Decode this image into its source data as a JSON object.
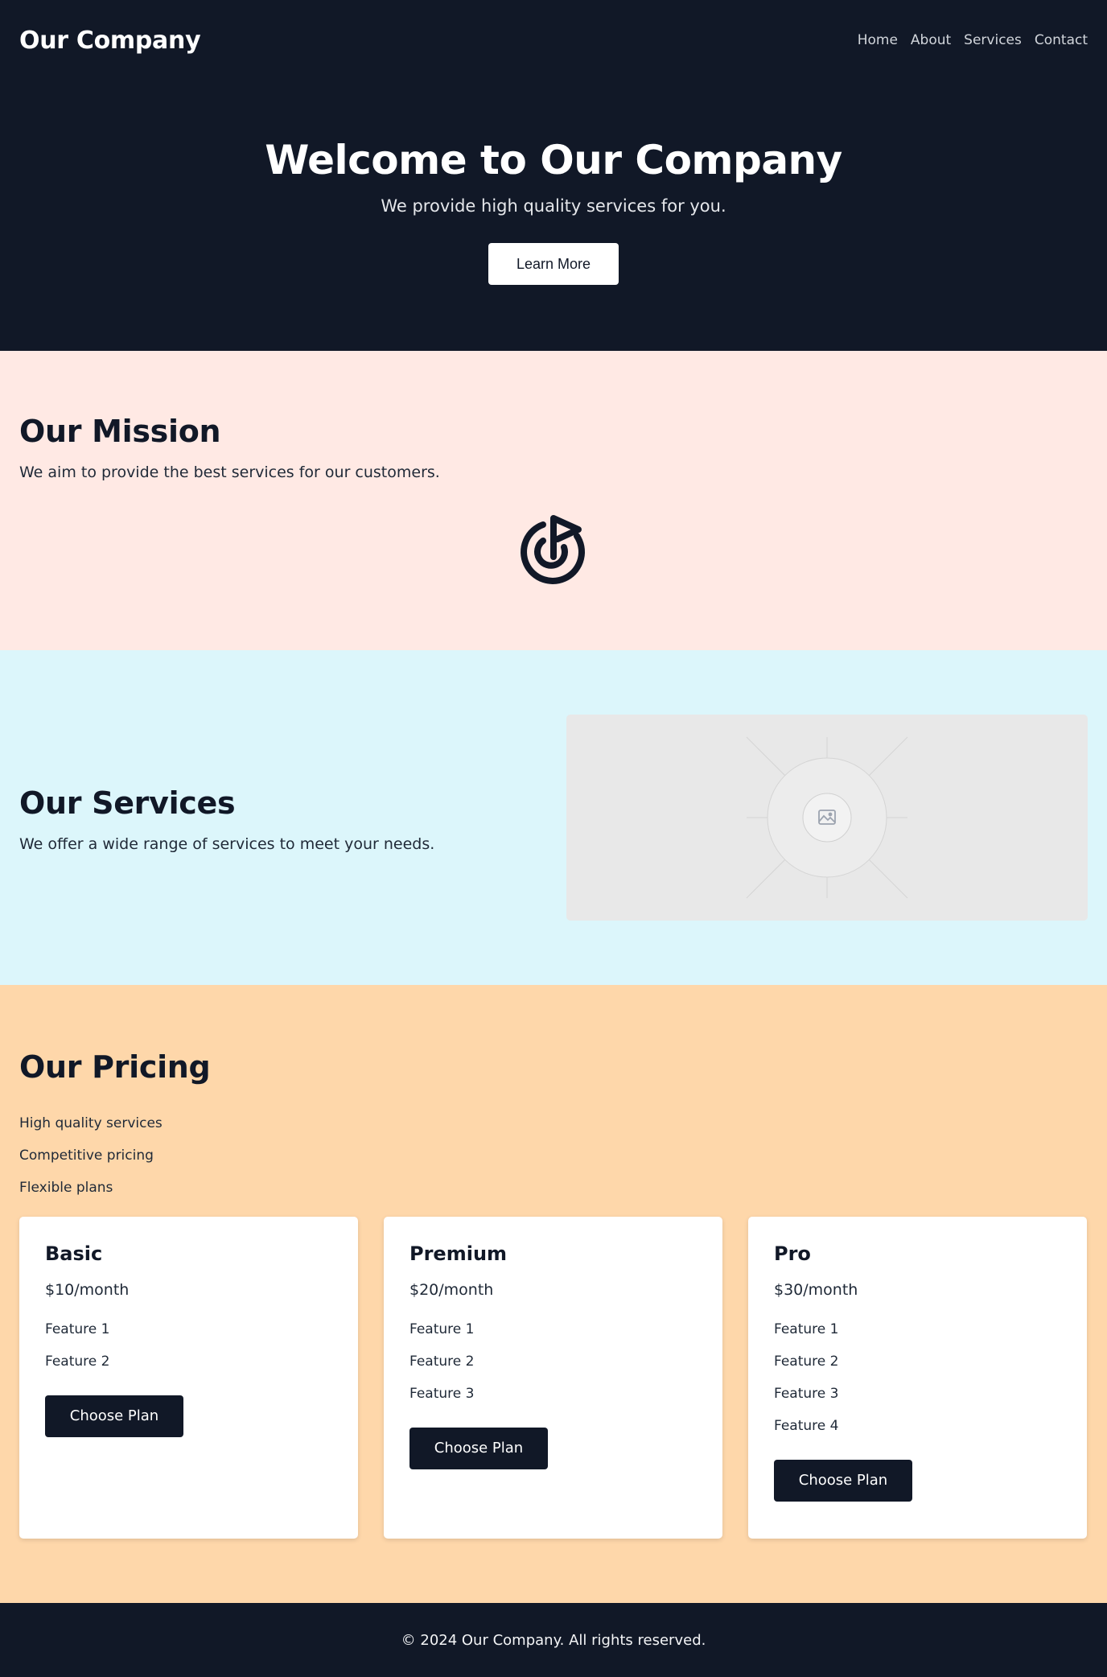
{
  "header": {
    "brand": "Our Company",
    "nav": [
      "Home",
      "About",
      "Services",
      "Contact"
    ]
  },
  "hero": {
    "title": "Welcome to Our Company",
    "subtitle": "We provide high quality services for you.",
    "cta_label": "Learn More"
  },
  "mission": {
    "title": "Our Mission",
    "text": "We aim to provide the best services for our customers.",
    "icon": "target-flag-icon"
  },
  "services": {
    "title": "Our Services",
    "text": "We offer a wide range of services to meet your needs.",
    "image_icon": "image-placeholder-icon"
  },
  "pricing": {
    "title": "Our Pricing",
    "highlights": [
      "High quality services",
      "Competitive pricing",
      "Flexible plans"
    ],
    "plans": [
      {
        "name": "Basic",
        "price": "$10/month",
        "features": [
          "Feature 1",
          "Feature 2"
        ],
        "cta": "Choose Plan"
      },
      {
        "name": "Premium",
        "price": "$20/month",
        "features": [
          "Feature 1",
          "Feature 2",
          "Feature 3"
        ],
        "cta": "Choose Plan"
      },
      {
        "name": "Pro",
        "price": "$30/month",
        "features": [
          "Feature 1",
          "Feature 2",
          "Feature 3",
          "Feature 4"
        ],
        "cta": "Choose Plan"
      }
    ]
  },
  "footer": {
    "text": "© 2024 Our Company. All rights reserved."
  },
  "colors": {
    "dark": "#111827",
    "mission_bg": "#ffe9e4",
    "services_bg": "#dcf6fb",
    "pricing_bg": "#fed7aa"
  }
}
